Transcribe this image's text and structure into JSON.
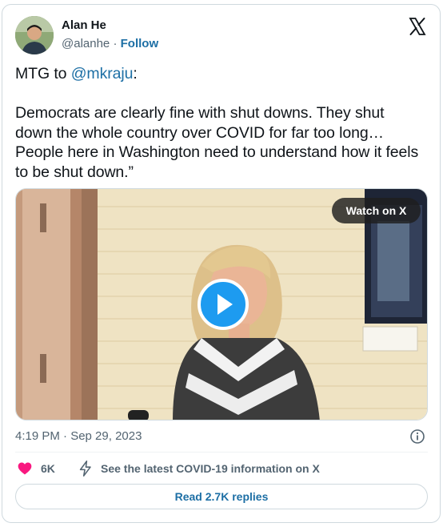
{
  "author": {
    "name": "Alan He",
    "handle": "@alanhe",
    "separator": "·",
    "follow_label": "Follow"
  },
  "tweet": {
    "intro_prefix": "MTG to ",
    "intro_mention": "@mkraju",
    "intro_suffix": ":",
    "lines": [
      "Democrats are clearly fine with shut downs. They shut",
      "down the whole country over COVID for far too long…",
      "People here in Washington need to understand how it feels",
      "to be shut down.”"
    ]
  },
  "media": {
    "watch_label": "Watch on X",
    "progress_fraction": 0
  },
  "meta": {
    "timestamp": "4:19 PM · Sep 29, 2023"
  },
  "actions": {
    "like_count": "6K",
    "covid_link": "See the latest COVID-19 information on X",
    "replies_label": "Read 2.7K replies"
  },
  "colors": {
    "link": "#1d6fa5",
    "heart": "#f91880",
    "play_button": "#1d9bf0",
    "secondary_text": "#536471"
  },
  "icons": {
    "logo": "x-logo-icon",
    "info": "info-icon",
    "like": "heart-icon",
    "covid": "lightning-icon",
    "play": "play-icon"
  }
}
